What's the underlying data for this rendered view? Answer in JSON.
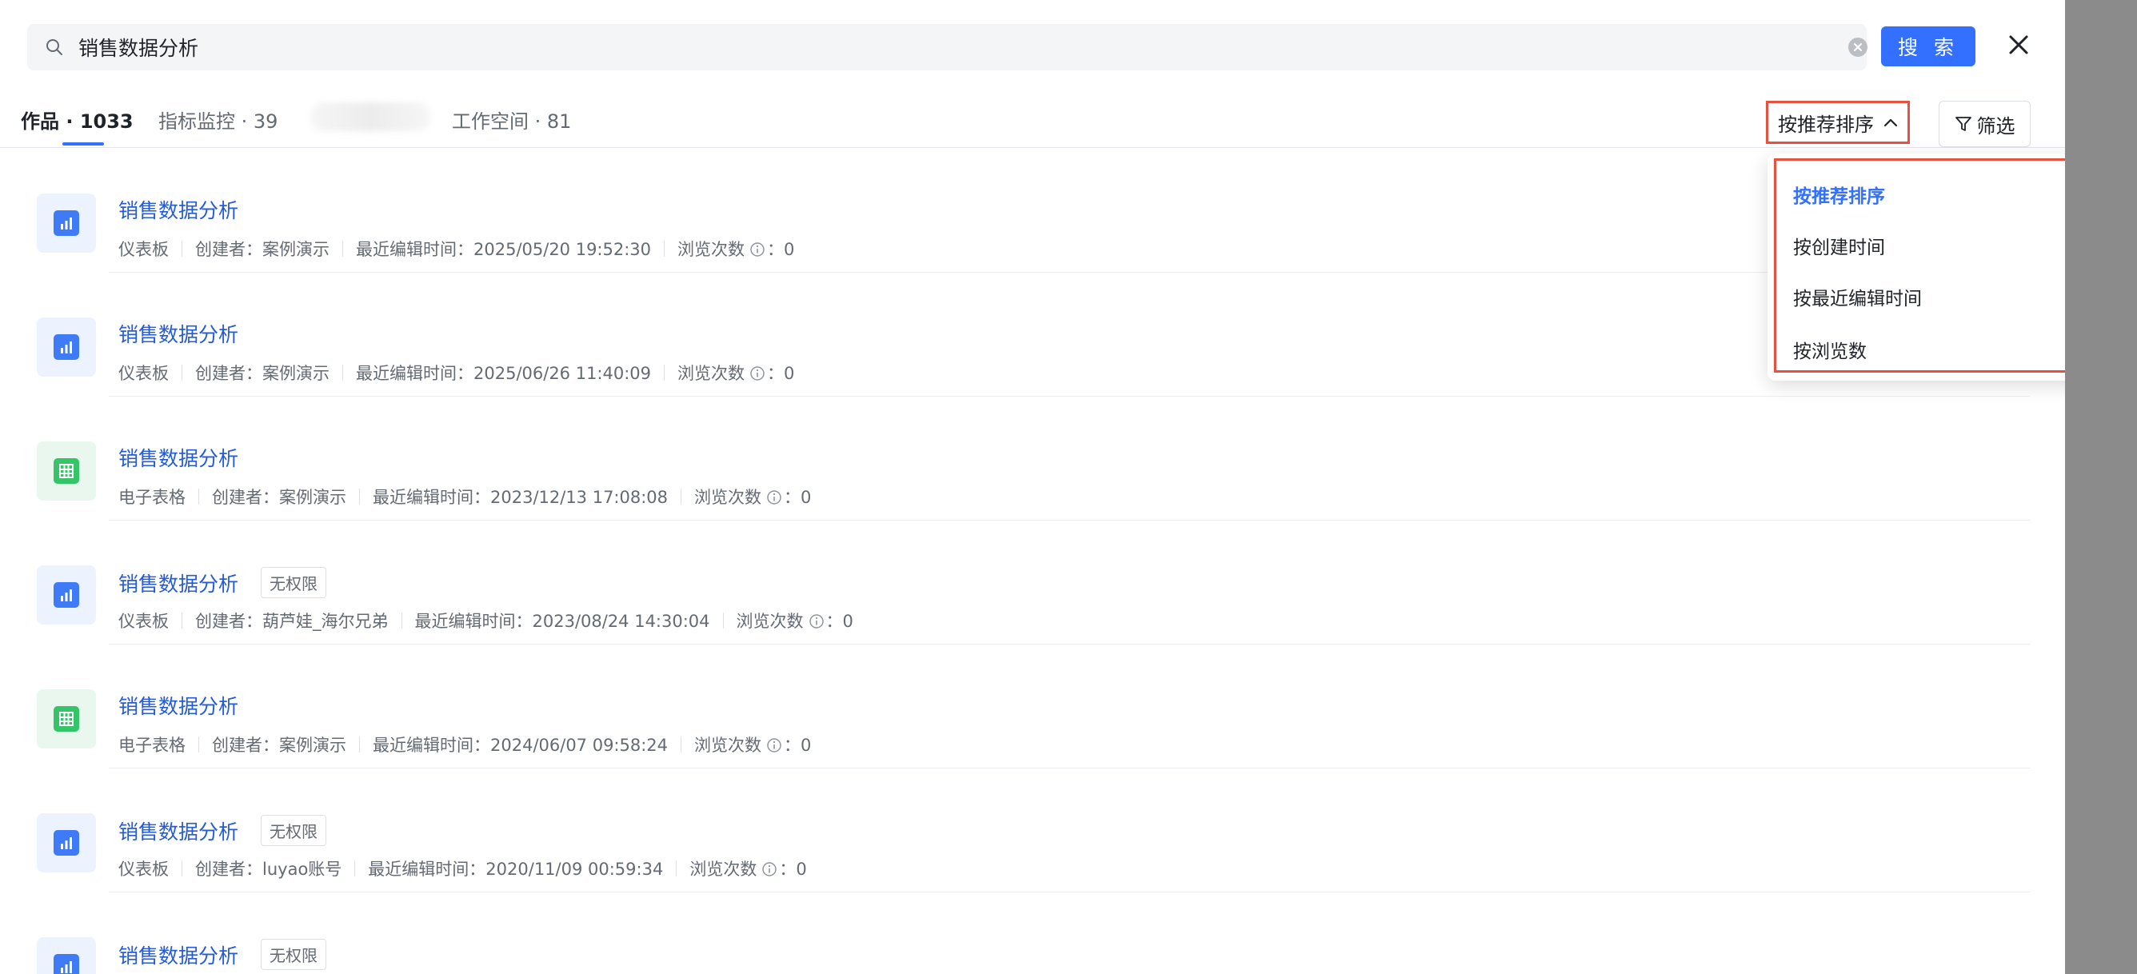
{
  "search": {
    "value": "销售数据分析",
    "button_label": "搜 索"
  },
  "tabs": [
    {
      "label": "作品 · 1033",
      "active": true
    },
    {
      "label": "指标监控 · 39",
      "active": false
    },
    {
      "label": "工作空间 · 81",
      "active": false
    }
  ],
  "sort": {
    "label": "按推荐排序",
    "options": [
      "按推荐排序",
      "按创建时间",
      "按最近编辑时间",
      "按浏览数"
    ],
    "selected_index": 0
  },
  "filter": {
    "label": "筛选"
  },
  "meta_labels": {
    "creator": "创建者：",
    "edited": "最近编辑时间：",
    "views": "浏览次数",
    "views_suffix": "：0"
  },
  "results": [
    {
      "title": "销售数据分析",
      "type": "仪表板",
      "icon": "dashboard-icon",
      "badge": "",
      "creator": "案例演示",
      "edited": "2025/05/20 19:52:30"
    },
    {
      "title": "销售数据分析",
      "type": "仪表板",
      "icon": "dashboard-icon",
      "badge": "",
      "creator": "案例演示",
      "edited": "2025/06/26 11:40:09"
    },
    {
      "title": "销售数据分析",
      "type": "电子表格",
      "icon": "spreadsheet-icon",
      "badge": "",
      "creator": "案例演示",
      "edited": "2023/12/13 17:08:08"
    },
    {
      "title": "销售数据分析",
      "type": "仪表板",
      "icon": "dashboard-icon",
      "badge": "无权限",
      "creator": "葫芦娃_海尔兄弟",
      "edited": "2023/08/24 14:30:04"
    },
    {
      "title": "销售数据分析",
      "type": "电子表格",
      "icon": "spreadsheet-icon",
      "badge": "",
      "creator": "案例演示",
      "edited": "2024/06/07 09:58:24"
    },
    {
      "title": "销售数据分析",
      "type": "仪表板",
      "icon": "dashboard-icon",
      "badge": "无权限",
      "creator": "luyao账号",
      "edited": "2020/11/09 00:59:34"
    },
    {
      "title": "销售数据分析",
      "type": "仪表板",
      "icon": "dashboard-icon",
      "badge": "无权限",
      "creator": "",
      "edited": ""
    }
  ],
  "colors": {
    "accent": "#3370ff",
    "highlight_border": "#e8503f",
    "title_link": "#245bdb",
    "dashboard_icon": "#3f7bf6",
    "spreadsheet_icon": "#35c468",
    "overlay": "#8b8b8b"
  }
}
